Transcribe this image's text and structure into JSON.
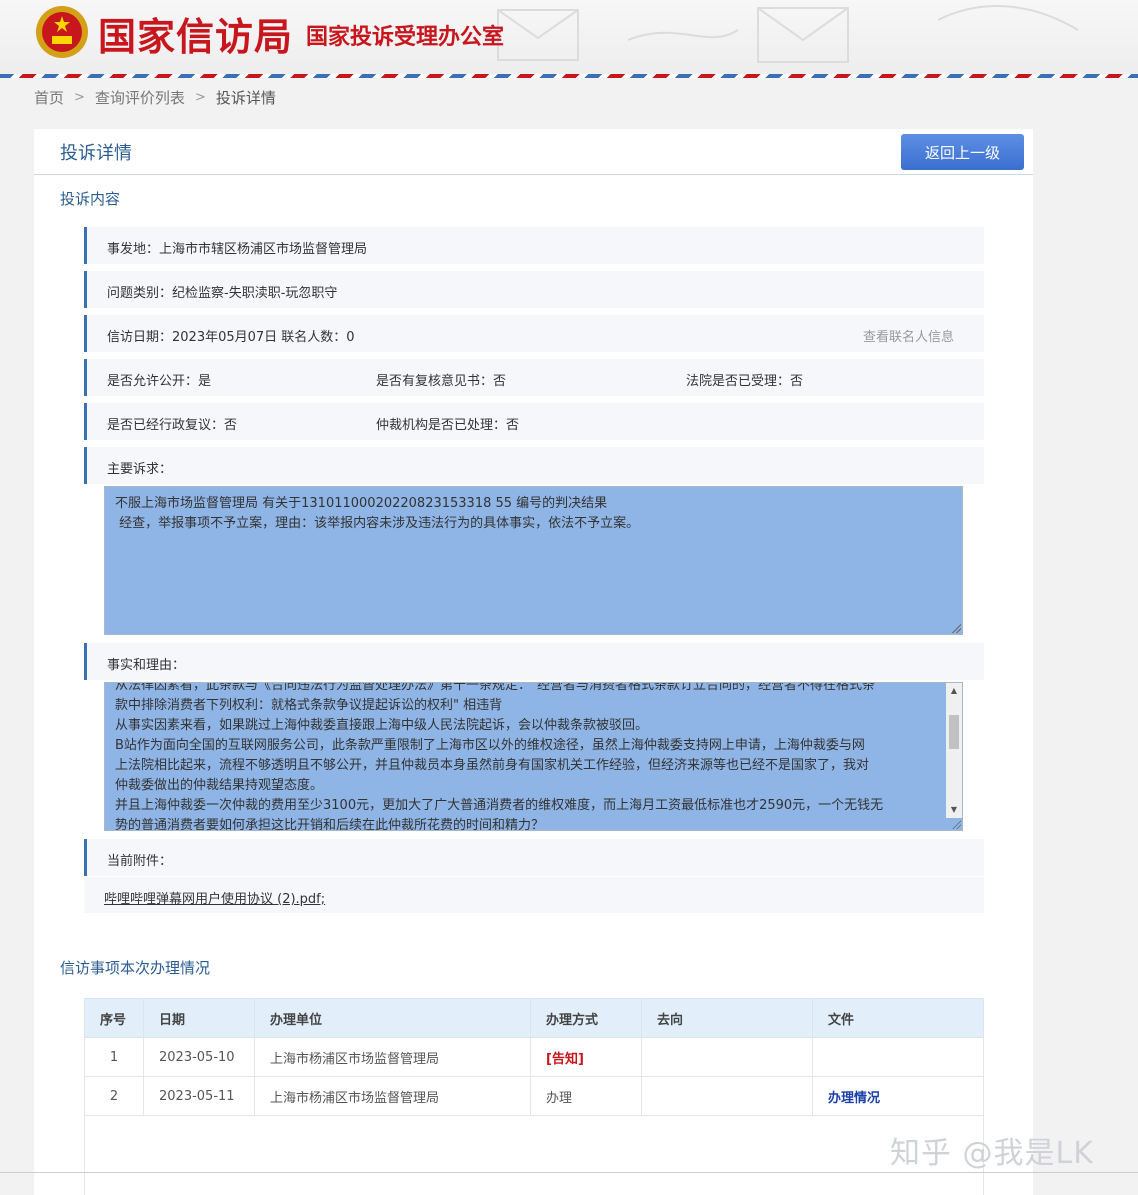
{
  "header": {
    "title": "国家信访局",
    "subtitle": "国家投诉受理办公室"
  },
  "breadcrumb": {
    "home": "首页",
    "list": "查询评价列表",
    "current": "投诉详情",
    "separator": ">"
  },
  "panel": {
    "title": "投诉详情",
    "back_button": "返回上一级"
  },
  "complaint": {
    "section_title": "投诉内容",
    "location": "事发地：上海市市辖区杨浦区市场监督管理局",
    "category": "问题类别：纪检监察-失职渎职-玩忽职守",
    "date_line": "信访日期：2023年05月07日 联名人数：0",
    "view_contacts": "查看联名人信息",
    "public": "是否允许公开：是",
    "review_opinion": "是否有复核意见书：否",
    "court": "法院是否已受理：否",
    "admin_review": "是否已经行政复议：否",
    "arbitration": "仲裁机构是否已处理：否",
    "main_claim_label": "主要诉求：",
    "main_claim_lines": [
      "不服上海市场监督管理局 有关于13101100020220823153318 55 编号的判决结果",
      " 经查，举报事项不予立案，理由：该举报内容未涉及违法行为的具体事实，依法不予立案。"
    ],
    "facts_label": "事实和理由：",
    "facts_lines": [
      "从法律因素看，此条款与《合同违法行为监督处理办法》第十一条规定：\"经营者与消费者格式条款订立合同的，经营者不得在格式条",
      "款中排除消费者下列权利：就格式条款争议提起诉讼的权利\" 相违背",
      "从事实因素来看，如果跳过上海仲裁委直接跟上海中级人民法院起诉，会以仲裁条款被驳回。",
      "B站作为面向全国的互联网服务公司，此条款严重限制了上海市区以外的维权途径，虽然上海仲裁委支持网上申请，上海仲裁委与网",
      "上法院相比起来，流程不够透明且不够公开，并且仲裁员本身虽然前身有国家机关工作经验，但经济来源等也已经不是国家了，我对",
      "仲裁委做出的仲裁结果持观望态度。",
      "并且上海仲裁委一次仲裁的费用至少3100元，更加大了广大普通消费者的维权难度，而上海月工资最低标准也才2590元，一个无钱无",
      "势的普通消费者要如何承担这比开销和后续在此仲裁所花费的时间和精力？"
    ],
    "attachment_label": "当前附件：",
    "attachment_name": "哔哩哔哩弹幕网用户使用协议 (2).pdf;"
  },
  "processing": {
    "section_title": "信访事项本次办理情况",
    "headers": [
      "序号",
      "日期",
      "办理单位",
      "办理方式",
      "去向",
      "文件"
    ],
    "rows": [
      {
        "idx": "1",
        "date": "2023-05-10",
        "unit": "上海市杨浦区市场监督管理局",
        "method": "[告知]",
        "dest": "",
        "file": ""
      },
      {
        "idx": "2",
        "date": "2023-05-11",
        "unit": "上海市杨浦区市场监督管理局",
        "method": "办理",
        "dest": "",
        "file": "办理情况"
      }
    ]
  },
  "watermark": "知乎 @我是LK",
  "icons": {
    "emblem": "national-emblem-icon",
    "scroll_up": "scroll-up-arrow-icon",
    "scroll_down": "scroll-down-arrow-icon"
  },
  "colors": {
    "brand_red": "#c8161d",
    "accent_blue": "#2b5d93",
    "button_blue": "#3a6fd0",
    "textarea_bg": "#8fb5e6"
  }
}
